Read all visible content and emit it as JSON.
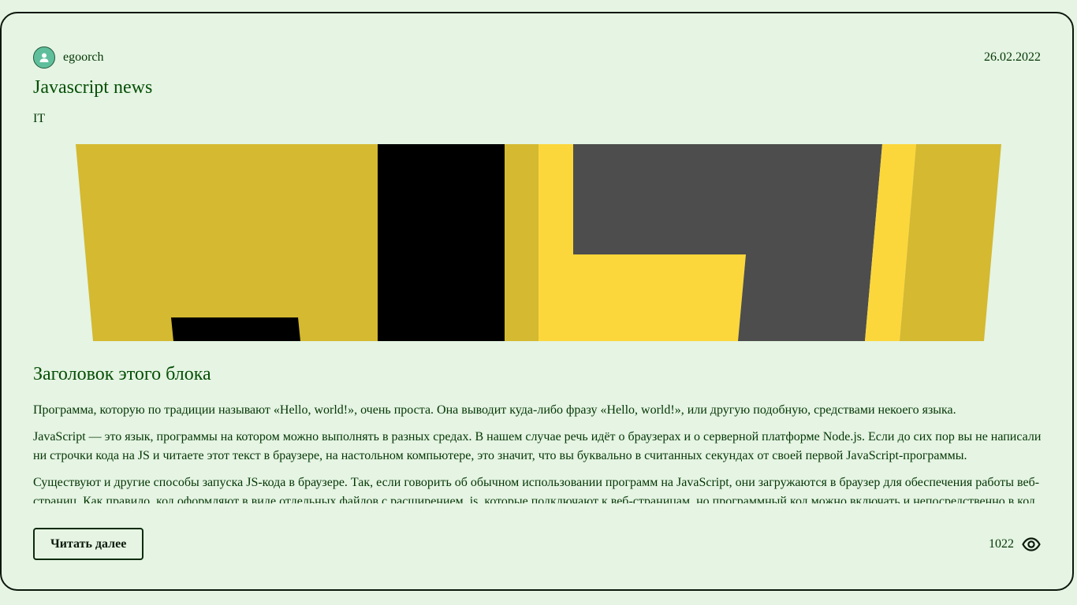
{
  "post": {
    "author": "egoorch",
    "date": "26.02.2022",
    "title": "Javascript news",
    "category": "IT",
    "block_title": "Заголовок этого блока",
    "paragraphs": [
      "Программа, которую по традиции называют «Hello, world!», очень проста. Она выводит куда-либо фразу «Hello, world!», или другую подобную, средствами некоего языка.",
      "JavaScript — это язык, программы на котором можно выполнять в разных средах. В нашем случае речь идёт о браузерах и о серверной платформе Node.js. Если до сих пор вы не написали ни строчки кода на JS и читаете этот текст в браузере, на настольном компьютере, это значит, что вы буквально в считанных секундах от своей первой JavaScript-программы.",
      "Существуют и другие способы запуска JS-кода в браузере. Так, если говорить об обычном использовании программ на JavaScript, они загружаются в браузер для обеспечения работы веб-страниц. Как правило, код оформляют в виде отдельных файлов с расширением .js, которые подключают к веб-страницам, но программный код можно включать и непосредственно в код страницы."
    ],
    "read_more_label": "Читать далее",
    "views": "1022"
  },
  "icons": {
    "avatar": "user-icon",
    "views": "eye-icon"
  },
  "colors": {
    "background": "#e5f4e3",
    "text": "#033603",
    "heading": "#064f06",
    "border": "#0d170d",
    "avatar": "#5fbf9c",
    "hero_yellow_dark": "#d4b931",
    "hero_yellow_light": "#fcd73b",
    "hero_gray": "#4d4d4d",
    "hero_black": "#000000"
  }
}
